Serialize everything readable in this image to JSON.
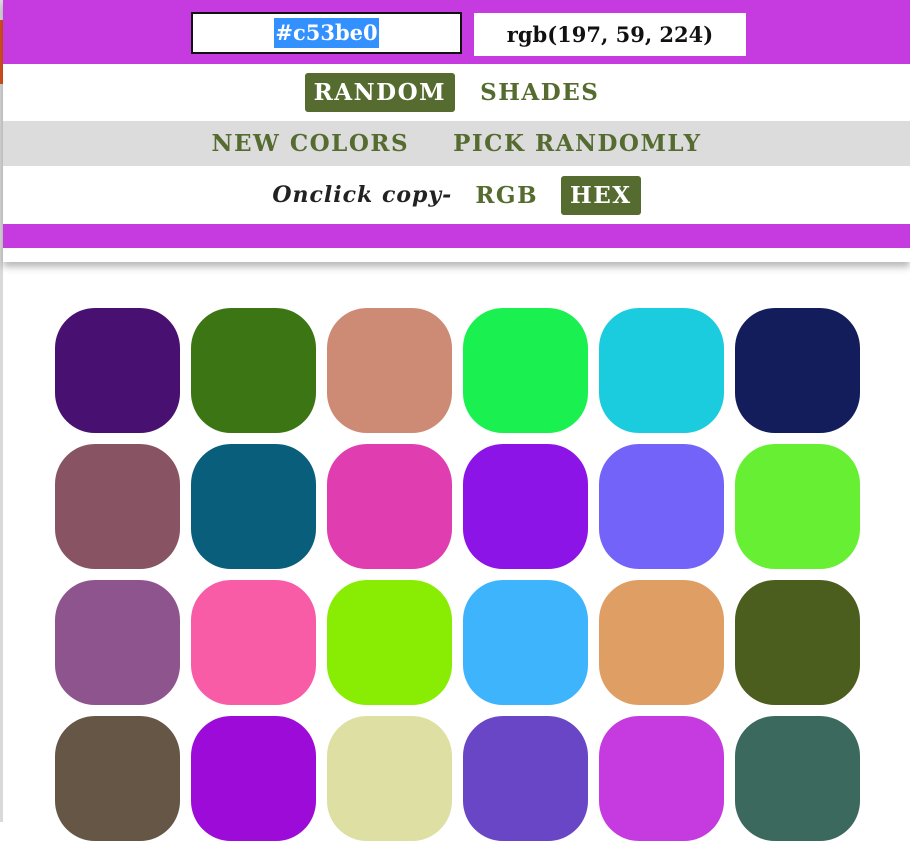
{
  "accent_color": "#c53be0",
  "selected": {
    "hex": "#c53be0",
    "rgb": "rgb(197, 59, 224)"
  },
  "modes": [
    {
      "label": "RANDOM",
      "active": true
    },
    {
      "label": "SHADES",
      "active": false
    }
  ],
  "actions": {
    "new_colors": "NEW COLORS",
    "pick_randomly": "PICK RANDOMLY"
  },
  "copy_format": {
    "label": "Onclick copy-",
    "options": [
      {
        "label": "RGB",
        "active": false
      },
      {
        "label": "HEX",
        "active": true
      }
    ]
  },
  "swatches": [
    "#481070",
    "#3c7614",
    "#cd8a74",
    "#1af150",
    "#1accde",
    "#141d5c",
    "#885464",
    "#095e7c",
    "#e03eb0",
    "#8c14e7",
    "#7463f8",
    "#67ef33",
    "#8d548d",
    "#f95ca6",
    "#88ec03",
    "#3eb4fd",
    "#df9e63",
    "#4c5e1e",
    "#665646",
    "#9c0bd8",
    "#dde0a2",
    "#6946c6",
    "#c53be0",
    "#3b695e"
  ]
}
